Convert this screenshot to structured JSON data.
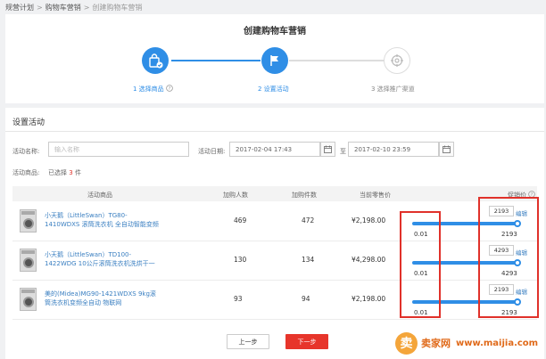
{
  "breadcrumb": {
    "items": [
      "规营计划",
      "购物车营销",
      "创建购物车营销"
    ],
    "sep": ">"
  },
  "page_title": "创建购物车营销",
  "steps": [
    {
      "label": "1 选择商品",
      "state": "done",
      "icon": "shopping-bag-check-icon"
    },
    {
      "label": "2 设置活动",
      "state": "active",
      "icon": "flag-icon"
    },
    {
      "label": "3 选择推广渠道",
      "state": "pending",
      "icon": "target-icon"
    }
  ],
  "colors": {
    "accent": "#2f8ee6",
    "highlight": "#e0312a",
    "primary_button": "#e7352b",
    "link": "#3a7fc1"
  },
  "section_title": "设置活动",
  "form": {
    "name_label": "活动名称:",
    "name_placeholder": "输入名称",
    "date_label": "活动日期:",
    "start_date": "2017-02-04 17:43",
    "end_date": "2017-02-10 23:59",
    "to_label": "至",
    "goods_label": "活动商品:",
    "selected_prefix": "已选择",
    "selected_count": "3",
    "selected_suffix": "件"
  },
  "table": {
    "headers": {
      "product": "活动商品",
      "buyers": "加购人数",
      "items": "加购件数",
      "price": "当前零售价",
      "promo": "促销价"
    },
    "rows": [
      {
        "name": "小天鹅（LittleSwan）TG80-1410WDXS 滚筒洗衣机 全自动智能变频8公...",
        "buyers": "469",
        "items": "472",
        "price": "¥2,198.00",
        "min": "0.01",
        "max": "2193",
        "promo": "2193",
        "promo_fraction": 1.0
      },
      {
        "name": "小天鹅（LittleSwan）TD100-1422WDG 10公斤滚筒洗衣机洗烘干一体机...",
        "buyers": "130",
        "items": "134",
        "price": "¥4,298.00",
        "min": "0.01",
        "max": "4293",
        "promo": "4293",
        "promo_fraction": 1.0
      },
      {
        "name": "美的(Midea)MG90-1421WDXS 9kg滚筒洗衣机变频全自动 物联网",
        "buyers": "93",
        "items": "94",
        "price": "¥2,198.00",
        "min": "0.01",
        "max": "2193",
        "promo": "2193",
        "promo_fraction": 1.0
      }
    ]
  },
  "edit_label": "编辑",
  "buttons": {
    "prev": "上一步",
    "next": "下一步"
  },
  "watermark": {
    "logo_char": "卖",
    "name": "卖家网",
    "url": "www.maijia.com"
  }
}
